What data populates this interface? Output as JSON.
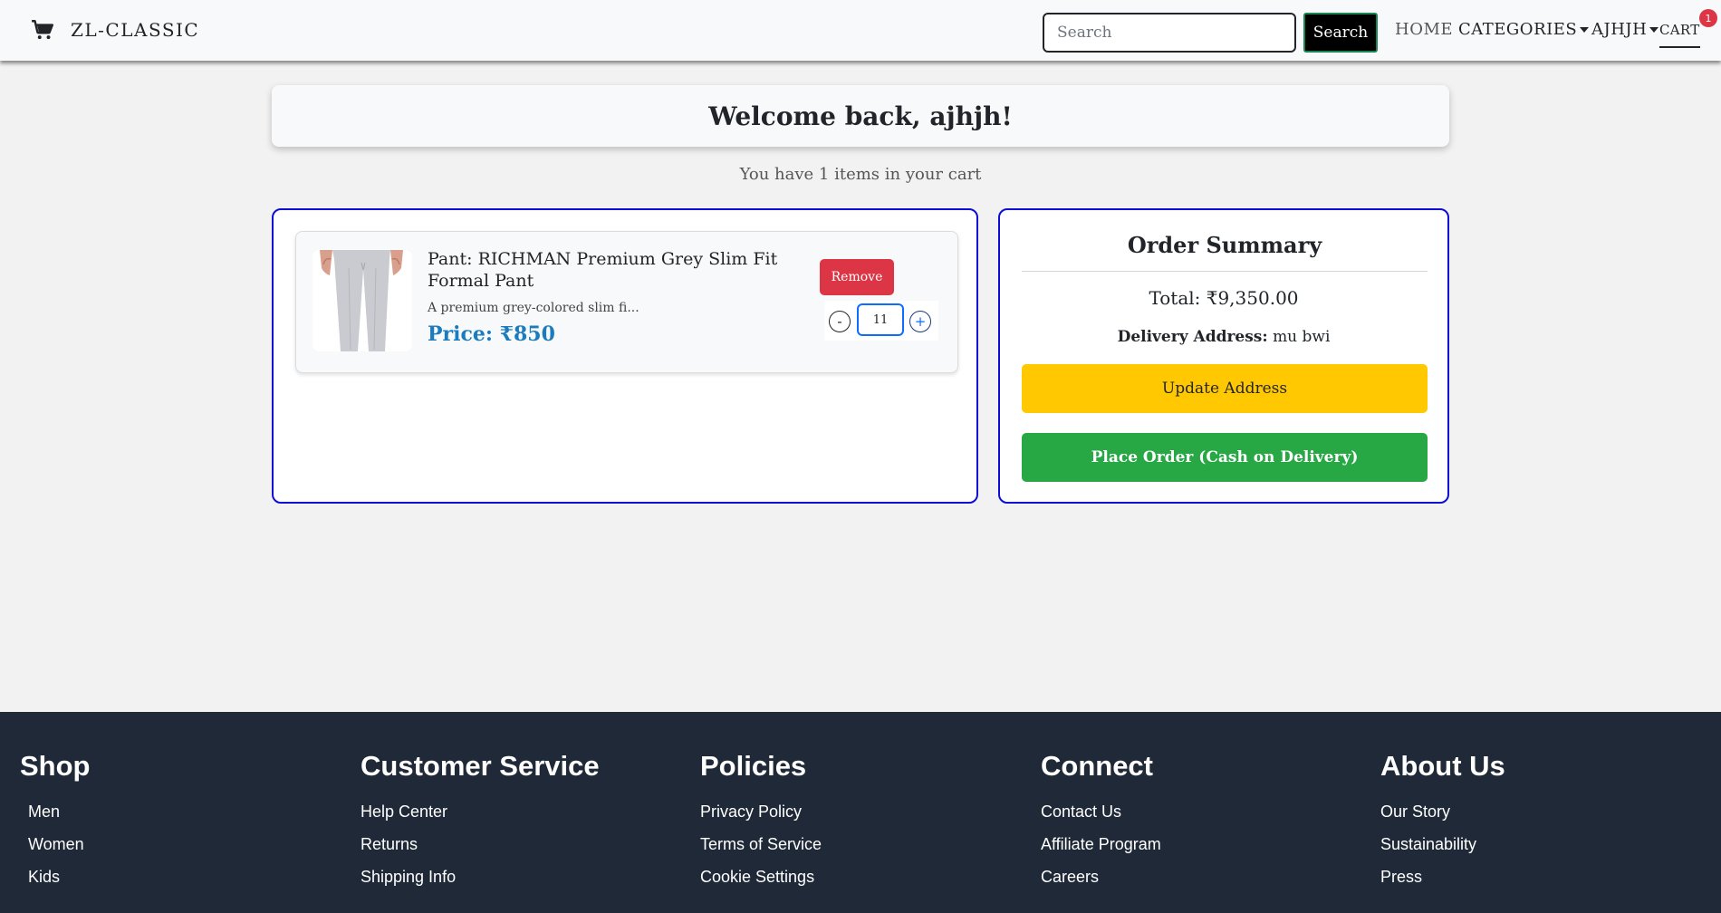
{
  "nav": {
    "brand": "ZL-CLASSIC",
    "search_placeholder": "Search",
    "search_button": "Search",
    "home": "HOME",
    "categories": "CATEGORIES",
    "user": "AJHJH",
    "cart": "CART",
    "cart_badge": "1"
  },
  "welcome": {
    "title": "Welcome back, ajhjh!",
    "cart_count_text": "You have 1 items in your cart"
  },
  "cart_items": [
    {
      "name": "Pant: RICHMAN Premium Grey Slim Fit Formal Pant",
      "description": "A premium grey-colored slim fi...",
      "price": "Price: ₹850",
      "remove_label": "Remove",
      "quantity": "11",
      "minus_label": "-",
      "plus_label": "+"
    }
  ],
  "summary": {
    "title": "Order Summary",
    "total": "Total: ₹9,350.00",
    "address_label": "Delivery Address:",
    "address_value": "mu bwi",
    "update_button": "Update Address",
    "order_button": "Place Order (Cash on Delivery)"
  },
  "footer": {
    "shop": {
      "title": "Shop",
      "items": [
        "Men",
        "Women",
        "Kids"
      ]
    },
    "customer_service": {
      "title": "Customer Service",
      "items": [
        "Help Center",
        "Returns",
        "Shipping Info"
      ]
    },
    "policies": {
      "title": "Policies",
      "items": [
        "Privacy Policy",
        "Terms of Service",
        "Cookie Settings"
      ]
    },
    "connect": {
      "title": "Connect",
      "items": [
        "Contact Us",
        "Affiliate Program",
        "Careers"
      ]
    },
    "about": {
      "title": "About Us",
      "items": [
        "Our Story",
        "Sustainability",
        "Press"
      ]
    }
  },
  "colors": {
    "accent_border": "#0d0dd6",
    "remove": "#dc3545",
    "update": "#ffc800",
    "order": "#28a745",
    "price": "#1a7bbf",
    "footer_bg": "#1f2937"
  }
}
